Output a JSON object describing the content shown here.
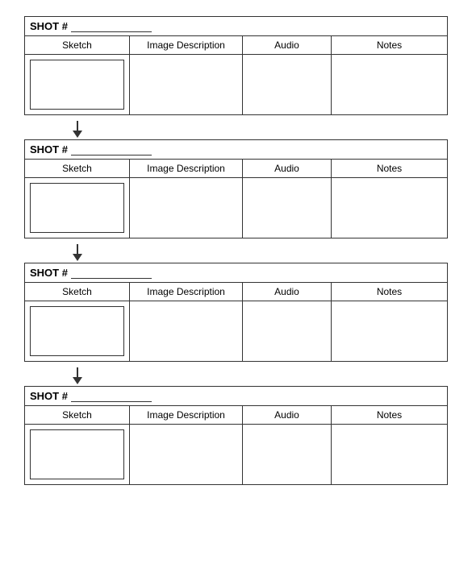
{
  "shots": [
    {
      "id": "shot-1",
      "label": "SHOT #",
      "columns": {
        "sketch": "Sketch",
        "imageDescription": "Image Description",
        "audio": "Audio",
        "notes": "Notes"
      }
    },
    {
      "id": "shot-2",
      "label": "SHOT #",
      "columns": {
        "sketch": "Sketch",
        "imageDescription": "Image Description",
        "audio": "Audio",
        "notes": "Notes"
      }
    },
    {
      "id": "shot-3",
      "label": "SHOT #",
      "columns": {
        "sketch": "Sketch",
        "imageDescription": "Image Description",
        "audio": "Audio",
        "notes": "Notes"
      }
    },
    {
      "id": "shot-4",
      "label": "SHOT #",
      "columns": {
        "sketch": "Sketch",
        "imageDescription": "Image Description",
        "audio": "Audio",
        "notes": "Notes"
      }
    }
  ]
}
